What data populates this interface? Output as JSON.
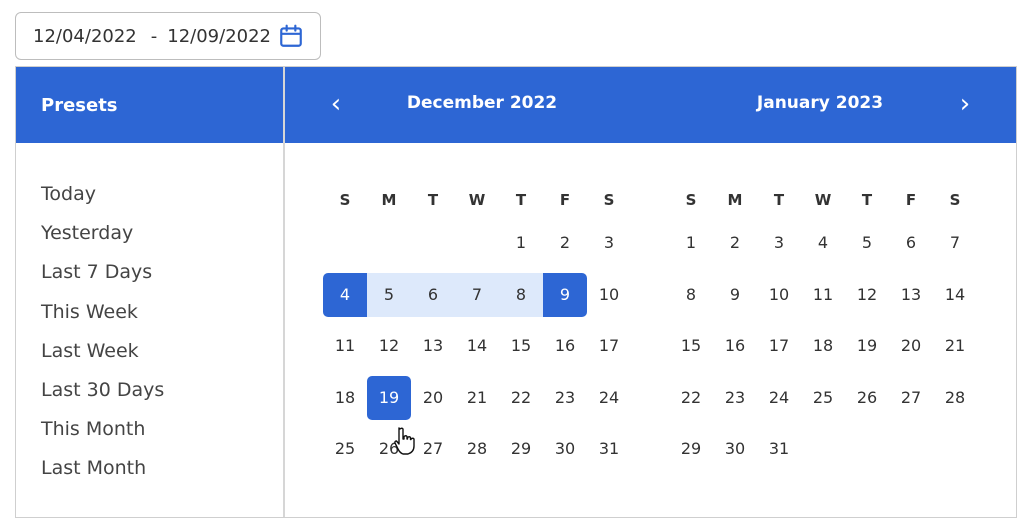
{
  "date_input": {
    "start": "12/04/2022",
    "separator": "-",
    "end": "12/09/2022",
    "icon": "calendar-icon"
  },
  "presets": {
    "header": "Presets",
    "items": [
      "Today",
      "Yesterday",
      "Last 7 Days",
      "This Week",
      "Last Week",
      "Last 30 Days",
      "This Month",
      "Last Month"
    ]
  },
  "calendar": {
    "prev_icon": "‹",
    "next_icon": "›",
    "accent_color": "#2d66d4",
    "range_color": "#dde9fb",
    "months": [
      {
        "title": "December 2022",
        "weekdays": [
          "S",
          "M",
          "T",
          "W",
          "T",
          "F",
          "S"
        ],
        "weeks": [
          [
            "",
            "",
            "",
            "",
            "1",
            "2",
            "3"
          ],
          [
            "4",
            "5",
            "6",
            "7",
            "8",
            "9",
            "10"
          ],
          [
            "11",
            "12",
            "13",
            "14",
            "15",
            "16",
            "17"
          ],
          [
            "18",
            "19",
            "20",
            "21",
            "22",
            "23",
            "24"
          ],
          [
            "25",
            "26",
            "27",
            "28",
            "29",
            "30",
            "31"
          ]
        ],
        "range_start": "4",
        "range_end": "9",
        "hovered": "19"
      },
      {
        "title": "January 2023",
        "weekdays": [
          "S",
          "M",
          "T",
          "W",
          "T",
          "F",
          "S"
        ],
        "weeks": [
          [
            "1",
            "2",
            "3",
            "4",
            "5",
            "6",
            "7"
          ],
          [
            "8",
            "9",
            "10",
            "11",
            "12",
            "13",
            "14"
          ],
          [
            "15",
            "16",
            "17",
            "18",
            "19",
            "20",
            "21"
          ],
          [
            "22",
            "23",
            "24",
            "25",
            "26",
            "27",
            "28"
          ],
          [
            "29",
            "30",
            "31",
            "",
            "",
            "",
            ""
          ]
        ]
      }
    ]
  }
}
